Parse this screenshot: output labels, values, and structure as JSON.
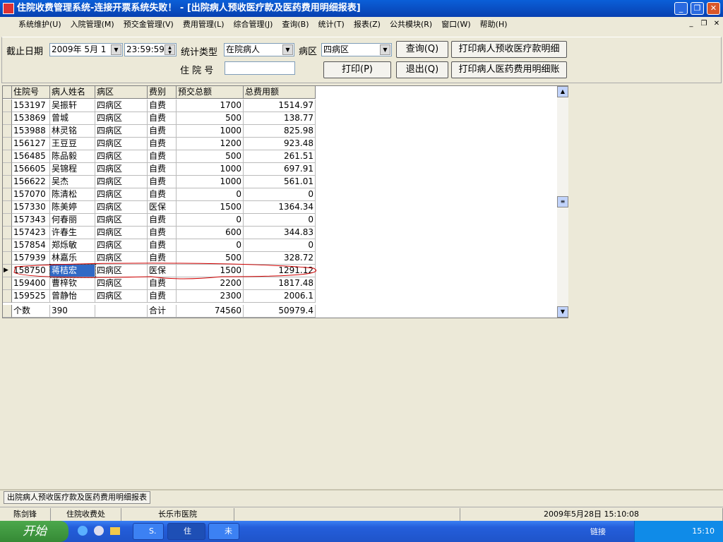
{
  "window": {
    "title": "住院收费管理系统-连接开票系统失败！ - [出院病人预收医疗款及医药费用明细报表]"
  },
  "menu": [
    "系统维护(U)",
    "入院管理(M)",
    "预交金管理(V)",
    "费用管理(L)",
    "综合管理(J)",
    "查询(B)",
    "统计(T)",
    "报表(Z)",
    "公共模块(R)",
    "窗口(W)",
    "帮助(H)"
  ],
  "filters": {
    "date_label": "截止日期",
    "date_value": "2009年 5月 1",
    "time_value": "23:59:59",
    "type_label": "统计类型",
    "type_value": "在院病人",
    "ward_label": "病区",
    "ward_value": "四病区",
    "inpatient_label": "住 院 号",
    "inpatient_value": ""
  },
  "buttons": {
    "query": "查询(Q)",
    "print": "打印(P)",
    "exit": "退出(Q)",
    "print_prepay": "打印病人预收医疗款明细",
    "print_fee": "打印病人医药费用明细账"
  },
  "table": {
    "columns": [
      "住院号",
      "病人姓名",
      "病区",
      "费别",
      "预交总额",
      "总费用额"
    ],
    "rows": [
      [
        "153197",
        "吴振轩",
        "四病区",
        "自费",
        "1700",
        "1514.97"
      ],
      [
        "153869",
        "曾城",
        "四病区",
        "自费",
        "500",
        "138.77"
      ],
      [
        "153988",
        "林灵铭",
        "四病区",
        "自费",
        "1000",
        "825.98"
      ],
      [
        "156127",
        "王豆豆",
        "四病区",
        "自费",
        "1200",
        "923.48"
      ],
      [
        "156485",
        "陈品毅",
        "四病区",
        "自费",
        "500",
        "261.51"
      ],
      [
        "156605",
        "吴锦程",
        "四病区",
        "自费",
        "1000",
        "697.91"
      ],
      [
        "156622",
        "吴杰",
        "四病区",
        "自费",
        "1000",
        "561.01"
      ],
      [
        "157070",
        "陈清松",
        "四病区",
        "自费",
        "0",
        "0"
      ],
      [
        "157330",
        "陈美婷",
        "四病区",
        "医保",
        "1500",
        "1364.34"
      ],
      [
        "157343",
        "何春丽",
        "四病区",
        "自费",
        "0",
        "0"
      ],
      [
        "157423",
        "许春生",
        "四病区",
        "自费",
        "600",
        "344.83"
      ],
      [
        "157854",
        "郑烁敏",
        "四病区",
        "自费",
        "0",
        "0"
      ],
      [
        "157939",
        "林嘉乐",
        "四病区",
        "自费",
        "500",
        "328.72"
      ],
      [
        "158750",
        "蒋桔宏",
        "四病区",
        "医保",
        "1500",
        "1291.12"
      ],
      [
        "159400",
        "曹梓钦",
        "四病区",
        "自费",
        "2200",
        "1817.48"
      ],
      [
        "159525",
        "曾静怡",
        "四病区",
        "自费",
        "2300",
        "2006.1"
      ]
    ],
    "selected_row": 13,
    "footer": [
      "个数",
      "390",
      "",
      "合计",
      "74560",
      "50979.4"
    ]
  },
  "tab": "出院病人预收医疗款及医药费用明细报表",
  "status": {
    "user": "陈剑锋",
    "dept": "住院收费处",
    "hospital": "长乐市医院",
    "datetime": "2009年5月28日 15:10:08"
  },
  "taskbar": {
    "start": "开始",
    "tasks": [
      "S.",
      "住",
      "未"
    ],
    "links": "链接",
    "clock": "15:10"
  },
  "colors": {
    "title": "#0a5fd8",
    "selection": "#316ac5",
    "annotation": "#d00000"
  }
}
